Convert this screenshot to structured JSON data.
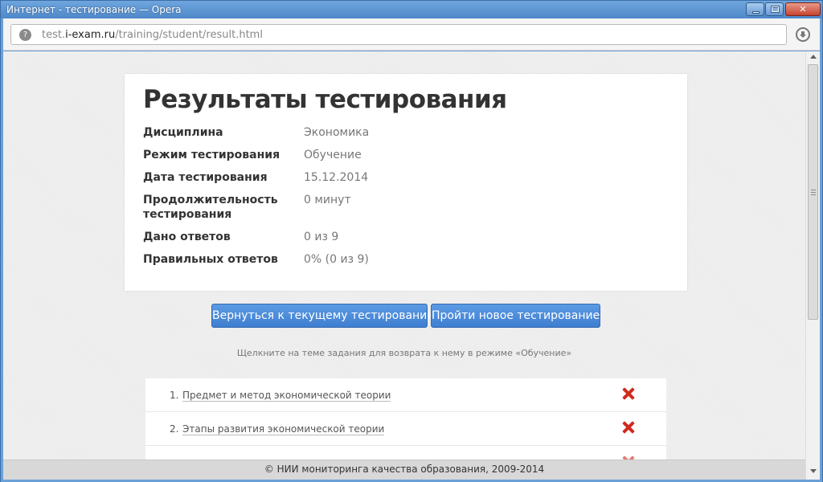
{
  "window": {
    "title": "Интернет - тестирование — Opera",
    "minimize_icon": "minimize-icon",
    "maximize_icon": "maximize-icon",
    "close_icon": "close-icon"
  },
  "address_bar": {
    "url_prefix": "test.",
    "url_host": "i-exam.ru",
    "url_path": "/training/student/result.html",
    "site_icon": "site-info-icon",
    "download_icon": "download-icon"
  },
  "result": {
    "title": "Результаты тестирования",
    "rows": [
      {
        "label": "Дисциплина",
        "value": "Экономика"
      },
      {
        "label": "Режим тестирования",
        "value": "Обучение"
      },
      {
        "label": "Дата тестирования",
        "value": "15.12.2014"
      },
      {
        "label": "Продолжительность тестирования",
        "value": "0 минут"
      },
      {
        "label": "Дано ответов",
        "value": "0 из 9"
      },
      {
        "label": "Правильных ответов",
        "value": "0% (0 из 9)"
      }
    ]
  },
  "buttons": {
    "return_label": "Вернуться к текущему тестированию",
    "new_label": "Пройти новое тестирование"
  },
  "hint": "Щелкните на теме задания для возврата к нему в режиме «Обучение»",
  "tasks": [
    {
      "num": "1.",
      "title": "Предмет и метод экономической теории",
      "status_icon": "wrong-x-icon"
    },
    {
      "num": "2.",
      "title": "Этапы развития экономической теории",
      "status_icon": "wrong-x-icon"
    }
  ],
  "footer": "© НИИ мониторинга качества образования, 2009-2014",
  "colors": {
    "accent": "#4a89da",
    "wrong": "#d02a1e",
    "titlebar": "#5a93d2"
  }
}
